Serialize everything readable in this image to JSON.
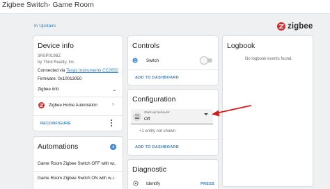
{
  "window": {
    "title": "Zigbee Switch- Game Room"
  },
  "breadcrumb": "In Upstairs",
  "brand": {
    "name": "zigbee",
    "color": "#d02b2b"
  },
  "device_info": {
    "title": "Device info",
    "model": "3RSP019BZ",
    "manufacturer": "by Third Reality, Inc",
    "connected_prefix": "Connected via",
    "connected_link": "Texas Instruments CC2652",
    "firmware": "Firmware: 0x10013050",
    "zigbee_info": "Zigbee info",
    "integration": "Zigbee Home Automation",
    "reconfigure": "RECONFIGURE"
  },
  "automations": {
    "title": "Automations",
    "items": [
      "Game Room Zigbee Switch OFF with w...",
      "Game Room Zigbee Switch ON with w..."
    ]
  },
  "controls": {
    "title": "Controls",
    "switch_label": "Switch",
    "switch_state": "off",
    "add_to_dashboard": "ADD TO DASHBOARD"
  },
  "configuration": {
    "title": "Configuration",
    "select_label": "Start-up behavior",
    "select_value": "Off",
    "hidden_note": "+1 entity not shown",
    "add_to_dashboard": "ADD TO DASHBOARD"
  },
  "diagnostic": {
    "title": "Diagnostic",
    "identify_label": "Identify",
    "press_label": "PRESS"
  },
  "logbook": {
    "title": "Logbook",
    "empty_text": "No logbook events found."
  },
  "annotation": {
    "arrow_color": "#d11a1a"
  }
}
